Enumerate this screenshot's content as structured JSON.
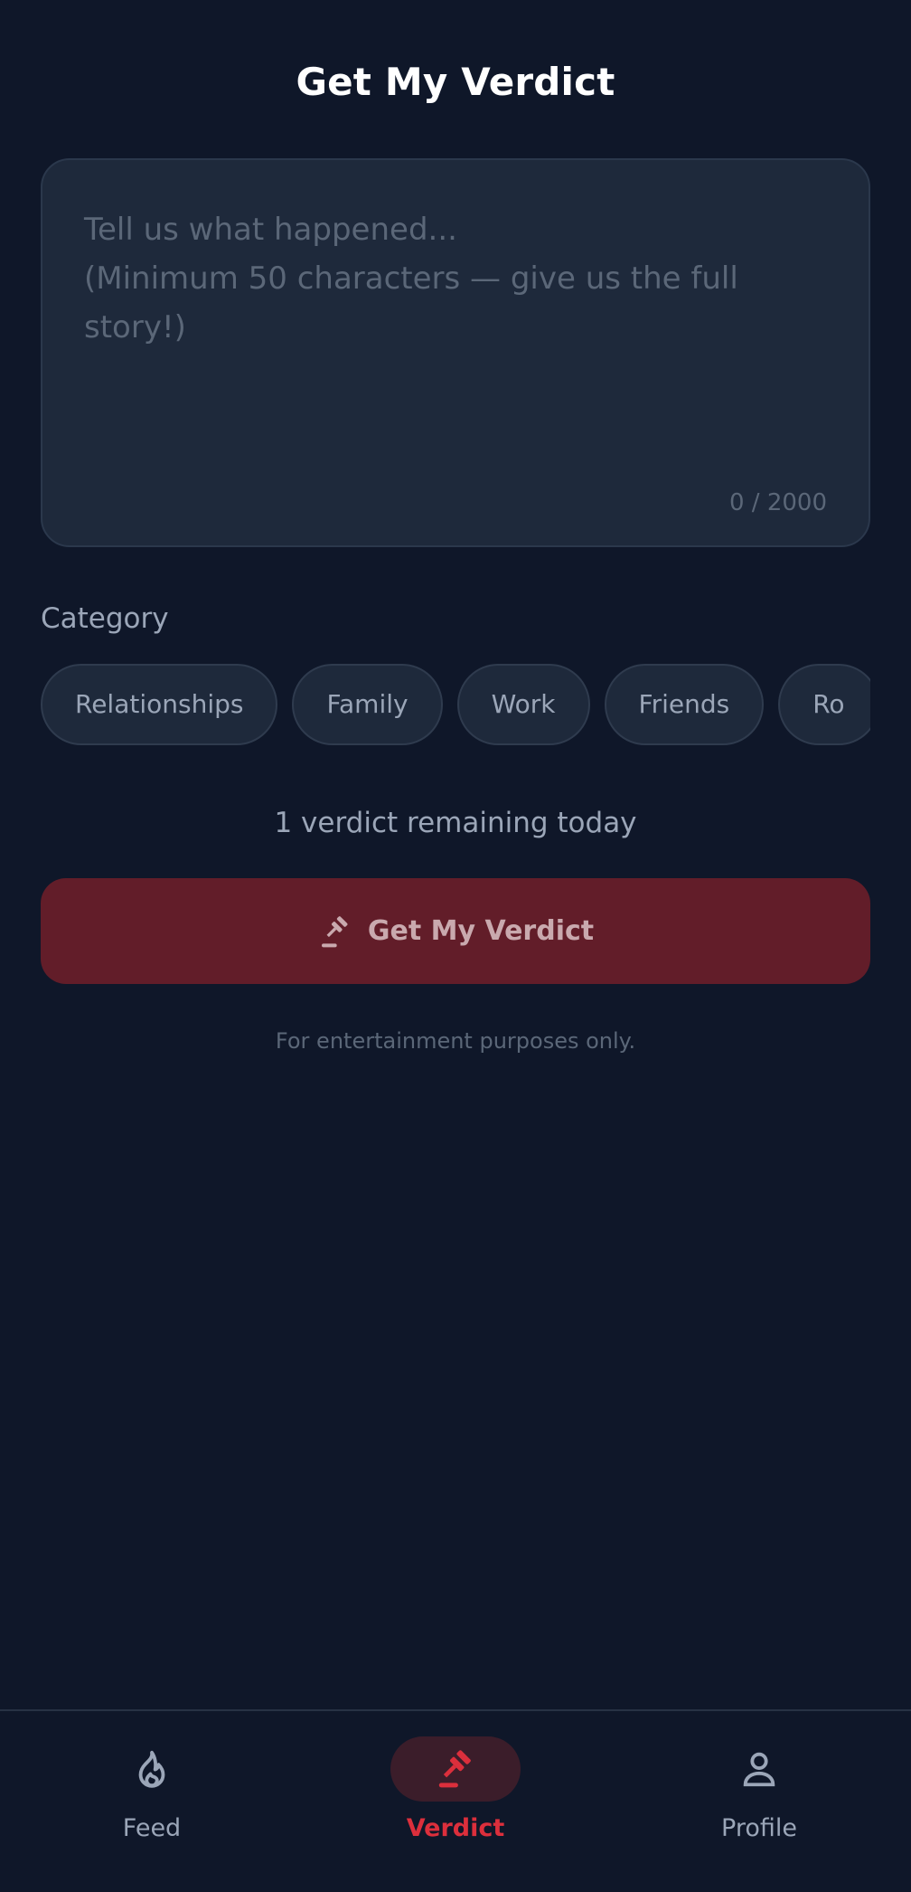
{
  "header": {
    "title": "Get My Verdict"
  },
  "story": {
    "placeholder": "Tell us what happened...\n(Minimum 50 characters — give us the full story!)",
    "value": "",
    "char_count": "0 / 2000"
  },
  "category": {
    "label": "Category",
    "chips": [
      "Relationships",
      "Family",
      "Work",
      "Friends",
      "Ro"
    ]
  },
  "remaining": {
    "text": "1 verdict remaining today"
  },
  "submit": {
    "label": "Get My Verdict",
    "icon": "gavel-icon"
  },
  "disclaimer": {
    "text": "For entertainment purposes only."
  },
  "nav": {
    "items": [
      {
        "label": "Feed",
        "icon": "flame-icon",
        "active": false
      },
      {
        "label": "Verdict",
        "icon": "gavel-icon",
        "active": true
      },
      {
        "label": "Profile",
        "icon": "person-icon",
        "active": false
      }
    ]
  },
  "colors": {
    "background": "#0f1729",
    "surface": "#1e293b",
    "accent": "#dc2f3c",
    "button_disabled": "#621d29",
    "muted_text": "#9ba6b8"
  }
}
